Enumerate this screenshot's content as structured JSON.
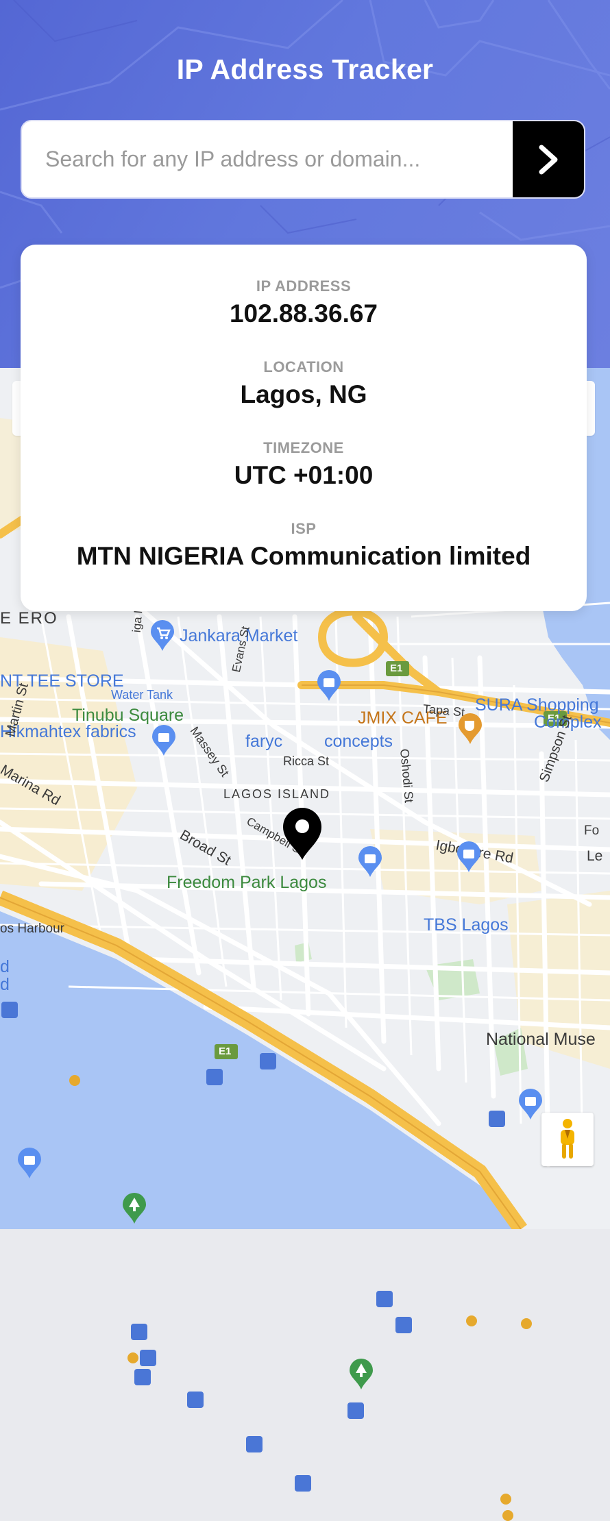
{
  "app": {
    "title": "IP Address Tracker"
  },
  "search": {
    "placeholder": "Search for any IP address or domain...",
    "value": ""
  },
  "info": {
    "ip_label": "IP ADDRESS",
    "ip": "102.88.36.67",
    "location_label": "LOCATION",
    "location": "Lagos, NG",
    "timezone_label": "TIMEZONE",
    "timezone": "UTC +01:00",
    "isp_label": "ISP",
    "isp": "MTN NIGERIA Communication limited"
  },
  "map": {
    "labels": {
      "ero": "E ERO",
      "jankara": "Jankara Market",
      "tee_store": "NT TEE STORE",
      "hikmahtex": "Hikmahtex fabrics",
      "jmix": "JMIX CAFE",
      "water_tank": "Water Tank",
      "tinubu": "Tinubu Square",
      "sura_1": "SURA Shopping",
      "sura_2": "Complex",
      "tapa": "Tapa St",
      "faryc_1": "faryc",
      "faryc_2": "concepts",
      "ricca": "Ricca St",
      "massey": "Massey St",
      "evans": "Evans St",
      "oshodi": "Oshodi St",
      "simpson": "Simpson St",
      "martin": "Martin St",
      "marina": "Marina Rd",
      "lagos_island": "LAGOS ISLAND",
      "broad": "Broad St",
      "campbell": "Campbell St",
      "igbosere": "Igbosere Rd",
      "freedom_park": "Freedom Park Lagos",
      "tbs": "TBS Lagos",
      "harbour": "os Harbour",
      "national_museum": "National Muse",
      "e1_a": "E1",
      "e1_b": "E1",
      "e1_c": "E1",
      "fo": "Fo",
      "le": "Le",
      "d1": "d",
      "d2": "d",
      "iga": "iga I"
    }
  },
  "colors": {
    "header": "#5c70da",
    "button": "#000000",
    "highway": "#f5c04a",
    "water": "#a8c4f5"
  }
}
